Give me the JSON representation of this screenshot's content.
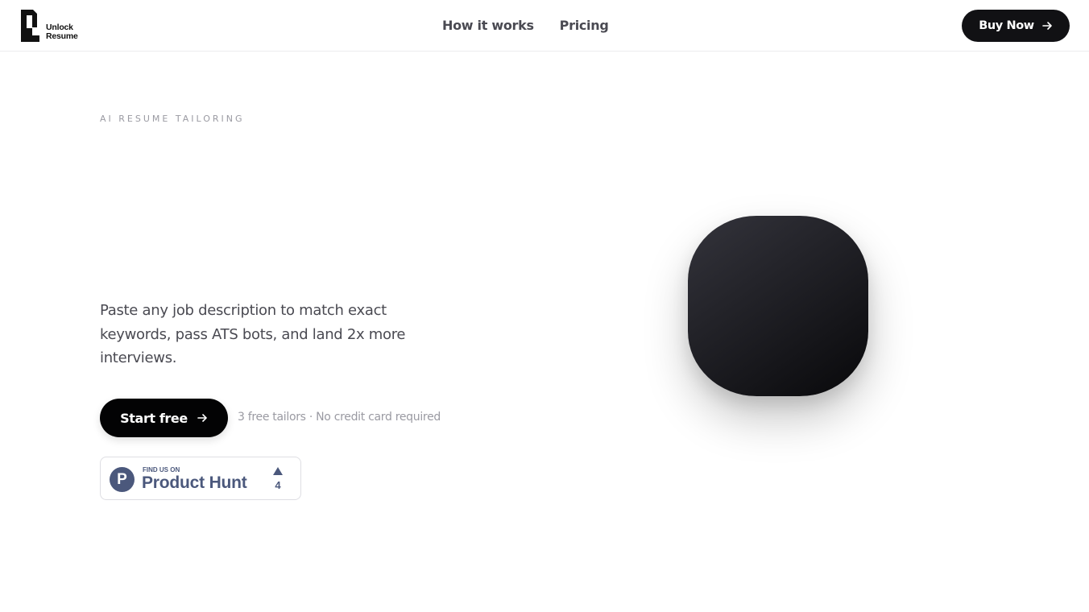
{
  "brand": {
    "line1": "Unlock",
    "line2": "Resume"
  },
  "nav": {
    "items": [
      {
        "label": "How it works"
      },
      {
        "label": "Pricing"
      }
    ]
  },
  "header": {
    "buy_label": "Buy Now",
    "buy_icon": "arrow-right-icon"
  },
  "hero": {
    "eyebrow": "AI RESUME TAILORING",
    "subtitle": "Paste any job description to match exact keywords, pass ATS bots, and land 2x more interviews.",
    "cta_label": "Start free",
    "cta_icon": "arrow-right-icon",
    "cta_note": "3 free tailors · No credit card required"
  },
  "product_hunt": {
    "logo_letter": "P",
    "small": "FIND US ON",
    "big": "Product Hunt",
    "votes": "4"
  },
  "colors": {
    "primary": "#111114",
    "product_hunt": "#4b587c",
    "muted_text": "#9a9aa2"
  }
}
